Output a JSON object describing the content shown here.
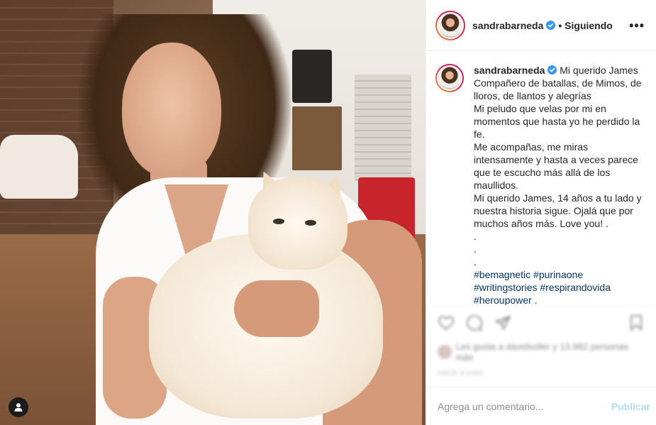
{
  "post": {
    "author": {
      "username": "sandrabarneda",
      "verified": true,
      "follow_state": "• Siguiendo"
    },
    "menu_icon": "more-dots-icon",
    "caption": {
      "username": "sandrabarneda",
      "text": "Mi querido James\nCompañero de batallas, de Mimos, de lloros, de llantos y alegrías\nMi peludo que velas por mi en momentos que hasta yo he perdido la fe.\nMe acompañas, me miras intensamente y hasta a veces parece que te escucho más allá de los maullidos.\nMi querido James, 14 años a tu lado y nuestra historia sigue. Ojalá que por muchos años más. Love you! .\n.\n.\n.",
      "hashtags_line1": "#bemagnetic #purinaone",
      "hashtags_line2": "#writingstories #respirandovida",
      "hashtags_line3": "#heroupower ."
    },
    "actions": {
      "icons": [
        "heart-icon",
        "comment-icon",
        "share-icon",
        "bookmark-icon"
      ],
      "likes_text": "Les gusta a davidsoller y 13.982 personas más",
      "timestamp": "HACE 3 DÍAS"
    },
    "comment_box": {
      "placeholder": "Agrega un comentario...",
      "publish_label": "Publicar"
    },
    "colors": {
      "verified_blue": "#3897f0",
      "link": "#003569",
      "publish_disabled": "#b3dbff"
    }
  }
}
